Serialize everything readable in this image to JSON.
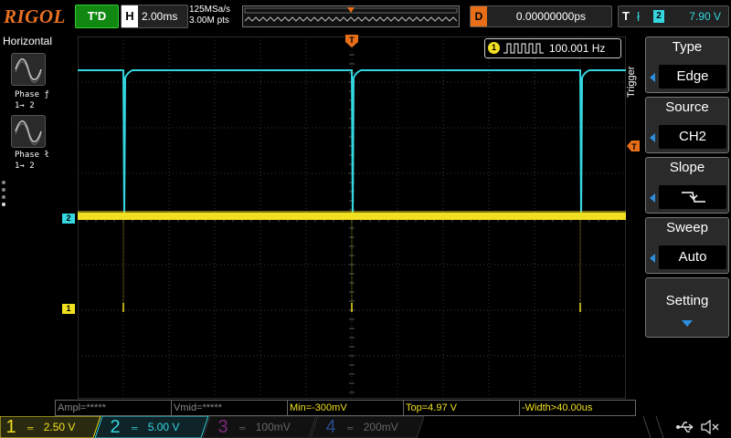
{
  "brand": "RIGOL",
  "status": {
    "run_state": "T'D"
  },
  "horizontal": {
    "label": "H",
    "timebase": "2.00ms",
    "sample_rate": "125MSa/s",
    "memory_depth": "3.00M pts"
  },
  "delay": {
    "label": "D",
    "value": "0.00000000ps"
  },
  "trigger_status": {
    "label": "T",
    "channel": "2",
    "level": "7.90 V"
  },
  "left_panel": {
    "title": "Horizontal",
    "items": [
      {
        "label_line1": "Phase ƒ",
        "label_line2": "1→ 2"
      },
      {
        "label_line1": "Phase ł",
        "label_line2": "1→ 2"
      }
    ]
  },
  "frequency_counter": {
    "channel": "1",
    "value": "100.001 Hz"
  },
  "trigger_menu": {
    "side_label": "Trigger",
    "type": {
      "title": "Type",
      "value": "Edge"
    },
    "source": {
      "title": "Source",
      "value": "CH2"
    },
    "slope": {
      "title": "Slope"
    },
    "sweep": {
      "title": "Sweep",
      "value": "Auto"
    },
    "setting": {
      "title": "Setting"
    }
  },
  "markers": {
    "ch2": "2",
    "ch1": "1"
  },
  "measurements": [
    {
      "text": "Ampl=*****"
    },
    {
      "text": "Vmid=*****"
    },
    {
      "text": "Min=-300mV"
    },
    {
      "text": "Top=4.97 V"
    },
    {
      "text": "-Width>40.00us"
    }
  ],
  "channels": [
    {
      "num": "1",
      "scale": "2.50 V",
      "color": "#f0e020",
      "active": true
    },
    {
      "num": "2",
      "scale": "5.00 V",
      "color": "#34d6e0",
      "active": true
    },
    {
      "num": "3",
      "scale": "100mV",
      "color": "#c030c0",
      "active": false
    },
    {
      "num": "4",
      "scale": "200mV",
      "color": "#3070e0",
      "active": false
    }
  ],
  "colors": {
    "ch1": "#f0e020",
    "ch2": "#34d6e0",
    "trigger": "#e86f18",
    "grid": "#3a3a3a",
    "menu_arrow": "#2b8fe0"
  },
  "icons": [
    "usb-icon",
    "speaker-mute-icon"
  ]
}
